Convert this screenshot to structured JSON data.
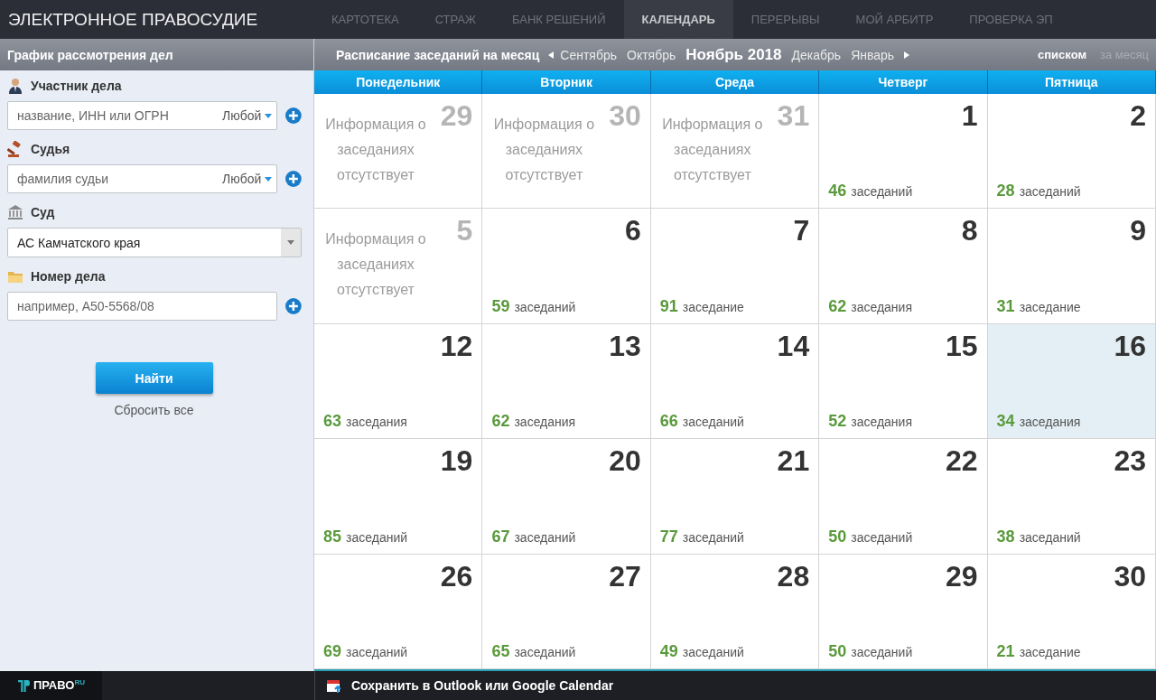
{
  "header": {
    "title": "ЭЛЕКТРОННОЕ ПРАВОСУДИЕ",
    "nav": [
      {
        "label": "КАРТОТЕКА",
        "selected": false
      },
      {
        "label": "СТРАЖ",
        "selected": false
      },
      {
        "label": "БАНК РЕШЕНИЙ",
        "selected": false
      },
      {
        "label": "КАЛЕНДАРЬ",
        "selected": true
      },
      {
        "label": "ПЕРЕРЫВЫ",
        "selected": false
      },
      {
        "label": "МОЙ АРБИТР",
        "selected": false
      },
      {
        "label": "ПРОВЕРКА ЭП",
        "selected": false
      }
    ]
  },
  "sidebar": {
    "title": "График рассмотрения дел",
    "filters": [
      {
        "kind": "input",
        "label": "Участник дела",
        "placeholder": "название, ИНН или ОГРН",
        "dropdown": "Любой"
      },
      {
        "kind": "input",
        "label": "Судья",
        "placeholder": "фамилия судьи",
        "dropdown": "Любой"
      },
      {
        "kind": "select",
        "label": "Суд",
        "value": "АС Камчатского края"
      },
      {
        "kind": "input",
        "label": "Номер дела",
        "placeholder": "например, А50-5568/08"
      }
    ],
    "search_button": "Найти",
    "reset_link": "Сбросить все"
  },
  "schedule": {
    "title": "Расписание заседаний на месяц",
    "months": [
      {
        "label": "Сентябрь",
        "selected": false
      },
      {
        "label": "Октябрь",
        "selected": false
      },
      {
        "label": "Ноябрь 2018",
        "selected": true
      },
      {
        "label": "Декабрь",
        "selected": false
      },
      {
        "label": "Январь",
        "selected": false
      }
    ],
    "views": [
      {
        "label": "списком",
        "selected": true
      },
      {
        "label": "за месяц",
        "selected": false
      }
    ],
    "weekdays": [
      "Понедельник",
      "Вторник",
      "Среда",
      "Четверг",
      "Пятница"
    ],
    "weeks": [
      [
        {
          "day": "29",
          "kind": "empty",
          "note": "Информация о заседаниях отсутствует",
          "selected": false
        },
        {
          "day": "30",
          "kind": "empty",
          "note": "Информация о заседаниях отсутствует",
          "selected": false
        },
        {
          "day": "31",
          "kind": "empty",
          "note": "Информация о заседаниях отсутствует",
          "selected": false
        },
        {
          "day": "1",
          "kind": "count",
          "count": "46",
          "unit": "заседаний",
          "selected": false
        },
        {
          "day": "2",
          "kind": "count",
          "count": "28",
          "unit": "заседаний",
          "selected": false
        }
      ],
      [
        {
          "day": "5",
          "kind": "empty",
          "note": "Информация о заседаниях отсутствует",
          "selected": false
        },
        {
          "day": "6",
          "kind": "count",
          "count": "59",
          "unit": "заседаний",
          "selected": false
        },
        {
          "day": "7",
          "kind": "count",
          "count": "91",
          "unit": "заседание",
          "selected": false
        },
        {
          "day": "8",
          "kind": "count",
          "count": "62",
          "unit": "заседания",
          "selected": false
        },
        {
          "day": "9",
          "kind": "count",
          "count": "31",
          "unit": "заседание",
          "selected": false
        }
      ],
      [
        {
          "day": "12",
          "kind": "count",
          "count": "63",
          "unit": "заседания",
          "selected": false
        },
        {
          "day": "13",
          "kind": "count",
          "count": "62",
          "unit": "заседания",
          "selected": false
        },
        {
          "day": "14",
          "kind": "count",
          "count": "66",
          "unit": "заседаний",
          "selected": false
        },
        {
          "day": "15",
          "kind": "count",
          "count": "52",
          "unit": "заседания",
          "selected": false
        },
        {
          "day": "16",
          "kind": "count",
          "count": "34",
          "unit": "заседания",
          "selected": true
        }
      ],
      [
        {
          "day": "19",
          "kind": "count",
          "count": "85",
          "unit": "заседаний",
          "selected": false
        },
        {
          "day": "20",
          "kind": "count",
          "count": "67",
          "unit": "заседаний",
          "selected": false
        },
        {
          "day": "21",
          "kind": "count",
          "count": "77",
          "unit": "заседаний",
          "selected": false
        },
        {
          "day": "22",
          "kind": "count",
          "count": "50",
          "unit": "заседаний",
          "selected": false
        },
        {
          "day": "23",
          "kind": "count",
          "count": "38",
          "unit": "заседаний",
          "selected": false
        }
      ],
      [
        {
          "day": "26",
          "kind": "count",
          "count": "69",
          "unit": "заседаний",
          "selected": false
        },
        {
          "day": "27",
          "kind": "count",
          "count": "65",
          "unit": "заседаний",
          "selected": false
        },
        {
          "day": "28",
          "kind": "count",
          "count": "49",
          "unit": "заседаний",
          "selected": false
        },
        {
          "day": "29",
          "kind": "count",
          "count": "50",
          "unit": "заседаний",
          "selected": false
        },
        {
          "day": "30",
          "kind": "count",
          "count": "21",
          "unit": "заседание",
          "selected": false
        }
      ]
    ]
  },
  "footer": {
    "logo": "ПРАВО$^{RU}$",
    "export_link": "Сохранить в Outlook или Google Calendar"
  }
}
